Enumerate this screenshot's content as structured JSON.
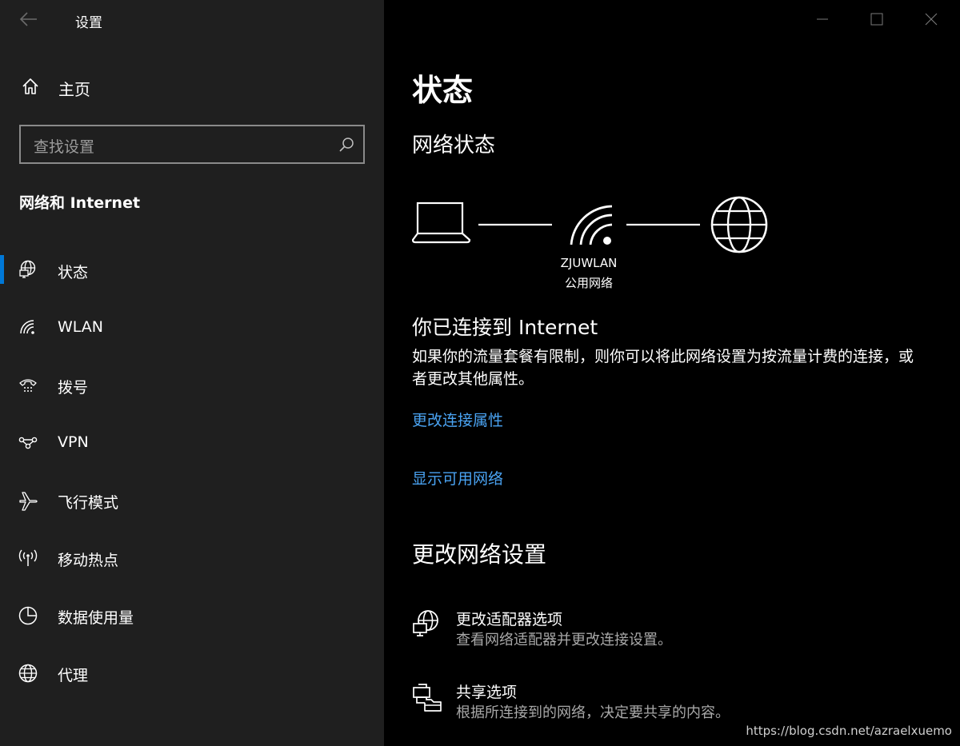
{
  "app": {
    "title": "设置"
  },
  "sidebar": {
    "home_label": "主页",
    "search_placeholder": "查找设置",
    "section_title": "网络和 Internet",
    "items": [
      {
        "label": "状态",
        "icon": "globe-monitor-icon",
        "selected": true
      },
      {
        "label": "WLAN",
        "icon": "wifi-icon",
        "selected": false
      },
      {
        "label": "拨号",
        "icon": "dialup-icon",
        "selected": false
      },
      {
        "label": "VPN",
        "icon": "vpn-icon",
        "selected": false
      },
      {
        "label": "飞行模式",
        "icon": "airplane-icon",
        "selected": false
      },
      {
        "label": "移动热点",
        "icon": "hotspot-icon",
        "selected": false
      },
      {
        "label": "数据使用量",
        "icon": "pie-chart-icon",
        "selected": false
      },
      {
        "label": "代理",
        "icon": "globe-icon",
        "selected": false
      }
    ]
  },
  "main": {
    "title": "状态",
    "network_status_heading": "网络状态",
    "network": {
      "name": "ZJUWLAN",
      "type": "公用网络"
    },
    "connected_title": "你已连接到 Internet",
    "connected_desc": "如果你的流量套餐有限制，则你可以将此网络设置为按流量计费的连接，或者更改其他属性。",
    "link_change_props": "更改连接属性",
    "link_show_networks": "显示可用网络",
    "change_settings_heading": "更改网络设置",
    "options": [
      {
        "title": "更改适配器选项",
        "desc": "查看网络适配器并更改连接设置。",
        "icon": "adapter-globe-icon"
      },
      {
        "title": "共享选项",
        "desc": "根据所连接到的网络，决定要共享的内容。",
        "icon": "sharing-icon"
      }
    ]
  },
  "watermark": "https://blog.csdn.net/azraelxuemo",
  "colors": {
    "sidebar_bg": "#1f1f1f",
    "main_bg": "#000000",
    "accent": "#0078d7",
    "link": "#4aa3f2"
  }
}
